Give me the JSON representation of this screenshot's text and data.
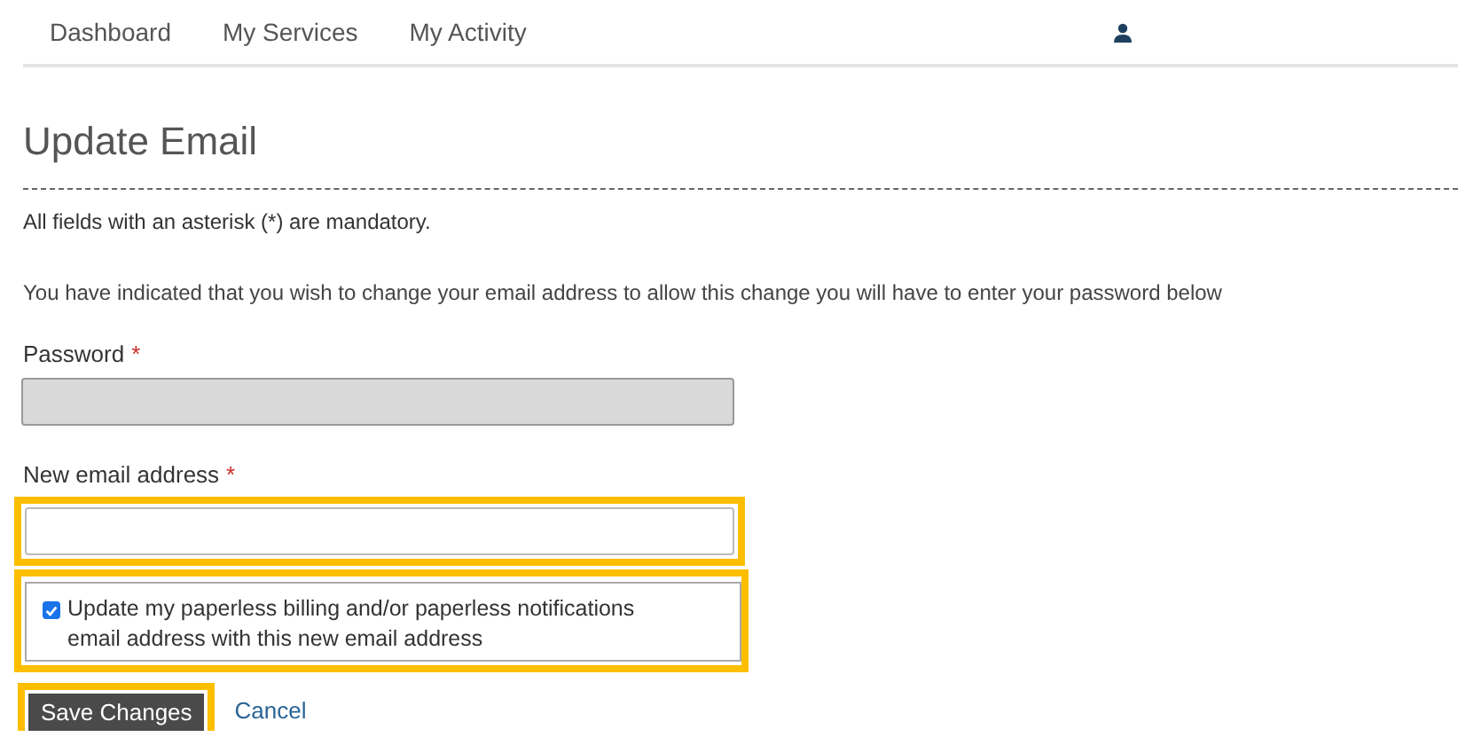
{
  "nav": {
    "items": [
      {
        "label": "Dashboard"
      },
      {
        "label": "My Services"
      },
      {
        "label": "My Activity"
      }
    ]
  },
  "title": "Update Email",
  "mandatory_note": "All fields with an asterisk (*) are mandatory.",
  "intro": "You have indicated that you wish to change your email address to allow this change you will have to enter your password below",
  "fields": [
    {
      "label": "Password",
      "required_mark": "*",
      "disabled": true,
      "highlighted": false
    },
    {
      "label": "New email address",
      "required_mark": "*",
      "disabled": false,
      "highlighted": true
    }
  ],
  "paperless_option": {
    "label": "Update my paperless billing and/or paperless notifications email address with this new email address",
    "checked": true,
    "highlighted": true
  },
  "buttons": {
    "save": {
      "label": "Save Changes",
      "highlighted": true
    },
    "cancel": {
      "label": "Cancel"
    }
  }
}
